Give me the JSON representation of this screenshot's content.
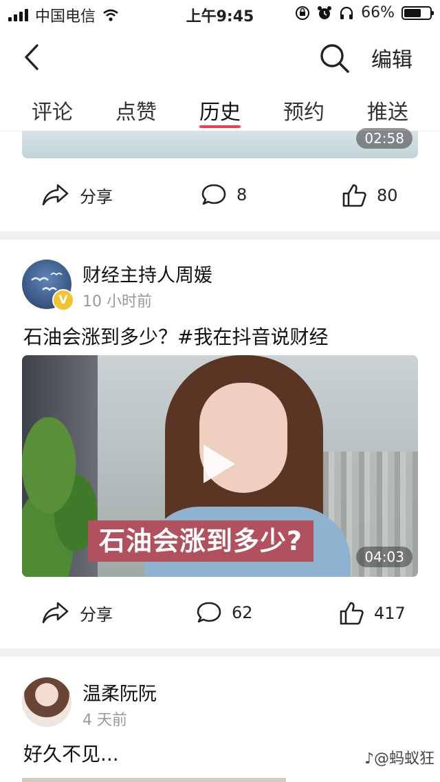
{
  "status_bar": {
    "carrier": "中国电信",
    "time": "上午9:45",
    "battery_percent": "66%",
    "battery_level": 0.66
  },
  "nav": {
    "edit_label": "编辑"
  },
  "tabs": [
    {
      "label": "评论",
      "active": false
    },
    {
      "label": "点赞",
      "active": false
    },
    {
      "label": "历史",
      "active": true
    },
    {
      "label": "预约",
      "active": false
    },
    {
      "label": "推送",
      "active": false
    }
  ],
  "feed": [
    {
      "duration": "02:58",
      "share_label": "分享",
      "comments": "8",
      "likes": "80"
    },
    {
      "author": "财经主持人周媛",
      "posted": "10 小时前",
      "text": "石油会涨到多少？#我在抖音说财经",
      "video_caption": "石油会涨到多少?",
      "duration": "04:03",
      "share_label": "分享",
      "comments": "62",
      "likes": "417",
      "verified_badge": "V"
    },
    {
      "author": "温柔阮阮",
      "posted": "4 天前",
      "text": "好久不见..."
    }
  ],
  "watermark": "@蚂蚁狂",
  "colors": {
    "accent": "#e8404f",
    "verified": "#f2c230",
    "caption_bg": "#b1505e"
  }
}
